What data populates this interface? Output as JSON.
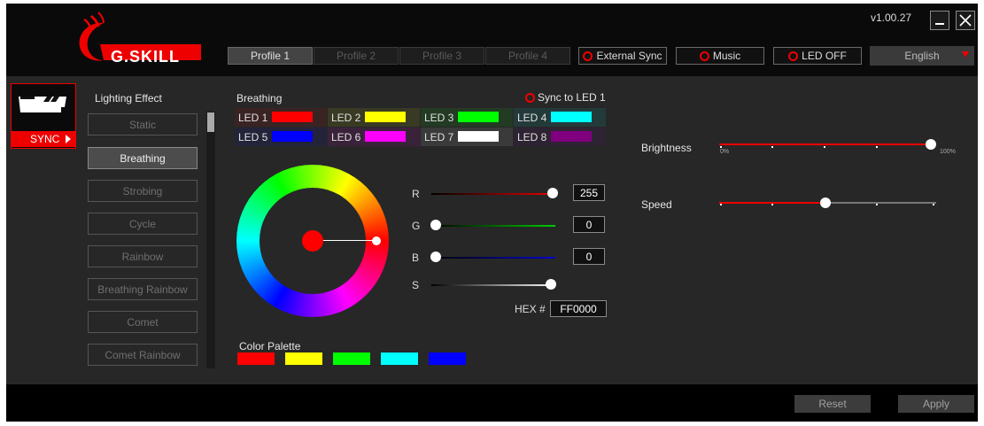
{
  "app": {
    "brand": "G.SKILL",
    "version": "v1.00.27",
    "colors": {
      "accent": "#e00000",
      "background": "#272727",
      "topbar": "#0a0a0a"
    }
  },
  "window": {
    "minimize_icon": "minimize-icon",
    "close_icon": "close-icon"
  },
  "profiles": [
    {
      "label": "Profile 1",
      "active": true
    },
    {
      "label": "Profile 2",
      "active": false
    },
    {
      "label": "Profile 3",
      "active": false
    },
    {
      "label": "Profile 4",
      "active": false
    }
  ],
  "modes": {
    "external_sync": "External Sync",
    "music": "Music",
    "led_off": "LED OFF"
  },
  "language": {
    "selected": "English"
  },
  "device": {
    "sync_label": "SYNC"
  },
  "lighting": {
    "heading": "Lighting Effect",
    "effects": [
      {
        "label": "Static",
        "active": false
      },
      {
        "label": "Breathing",
        "active": true
      },
      {
        "label": "Strobing",
        "active": false
      },
      {
        "label": "Cycle",
        "active": false
      },
      {
        "label": "Rainbow",
        "active": false
      },
      {
        "label": "Breathing Rainbow",
        "active": false
      },
      {
        "label": "Comet",
        "active": false
      },
      {
        "label": "Comet Rainbow",
        "active": false
      }
    ]
  },
  "effect_panel": {
    "title": "Breathing",
    "sync_to_led": "Sync to LED 1",
    "leds": [
      {
        "label": "LED 1",
        "color": "#ff0000"
      },
      {
        "label": "LED 2",
        "color": "#ffff00"
      },
      {
        "label": "LED 3",
        "color": "#00ff00"
      },
      {
        "label": "LED 4",
        "color": "#00ffff"
      },
      {
        "label": "LED 5",
        "color": "#0000ff"
      },
      {
        "label": "LED 6",
        "color": "#ff00ff"
      },
      {
        "label": "LED 7",
        "color": "#ffffff"
      },
      {
        "label": "LED 8",
        "color": "#800080"
      }
    ]
  },
  "color": {
    "r_label": "R",
    "r_value": "255",
    "g_label": "G",
    "g_value": "0",
    "b_label": "B",
    "b_value": "0",
    "s_label": "S",
    "hex_label": "HEX #",
    "hex_value": "FF0000",
    "selected_color": "#ff0000"
  },
  "palette": {
    "heading": "Color Palette",
    "colors": [
      "#ff0000",
      "#ffff00",
      "#00ff00",
      "#00ffff",
      "#0000ff"
    ]
  },
  "brightness": {
    "label": "Brightness",
    "min_label": "0%",
    "max_label": "100%",
    "value_percent": 100
  },
  "speed": {
    "label": "Speed",
    "value_fraction": 0.5
  },
  "footer": {
    "reset": "Reset",
    "apply": "Apply"
  }
}
